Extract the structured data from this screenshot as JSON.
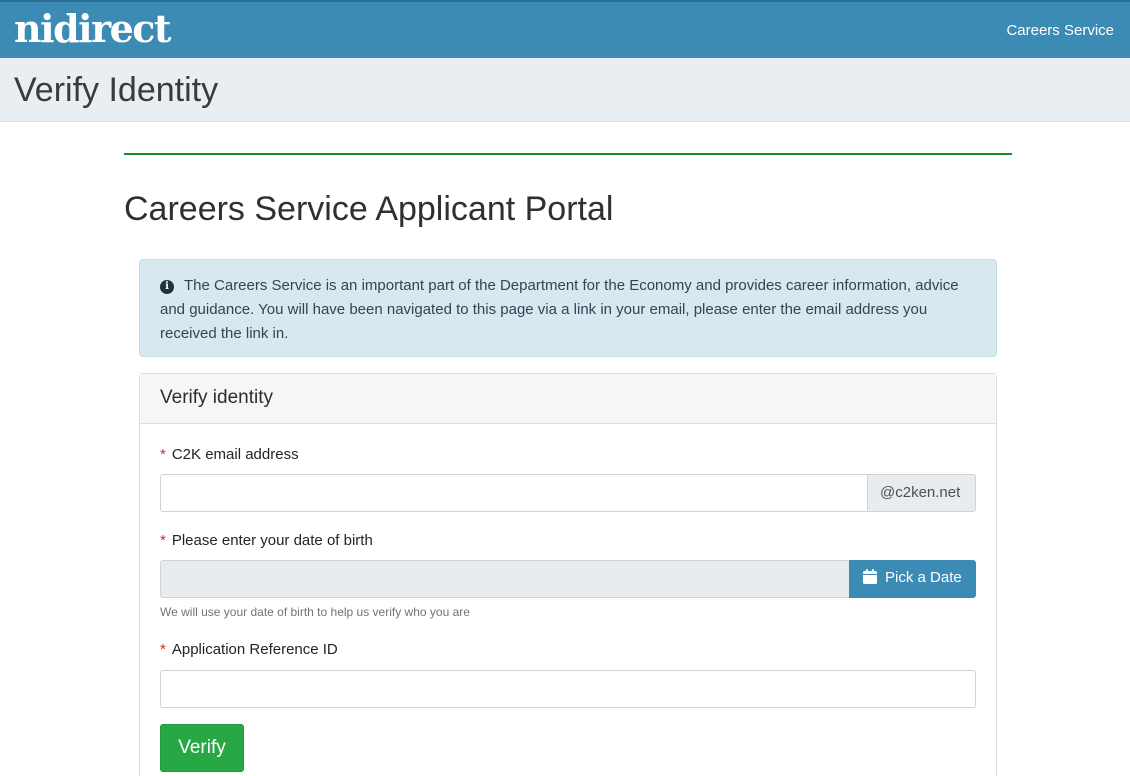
{
  "header": {
    "logo_text": "nidirect",
    "service_link": "Careers Service"
  },
  "page_title": "Verify Identity",
  "main": {
    "portal_title": "Careers Service Applicant Portal",
    "alert_text": "The Careers Service is an important part of the Department for the Economy and provides career information, advice and guidance. You will have been navigated to this page via a link in your email, please enter the email address you received the link in."
  },
  "form": {
    "panel_title": "Verify identity",
    "required_marker": "*",
    "email_label": "C2K email address",
    "email_value": "",
    "email_suffix": "@c2ken.net",
    "dob_label": "Please enter your date of birth",
    "dob_value": "",
    "dob_button_label": "Pick a Date",
    "dob_help": "We will use your date of birth to help us verify who you are",
    "ref_label": "Application Reference ID",
    "ref_value": "",
    "verify_label": "Verify"
  },
  "colors": {
    "header_bg": "#3b8bb5",
    "title_bar_bg": "#e9eef2",
    "rule_green": "#168a2a",
    "alert_bg": "#d7e8f1",
    "verify_green": "#27a844",
    "required_red": "#d12b2b"
  },
  "icons": {
    "alert": "info-circle-icon",
    "date_button": "calendar-icon"
  }
}
